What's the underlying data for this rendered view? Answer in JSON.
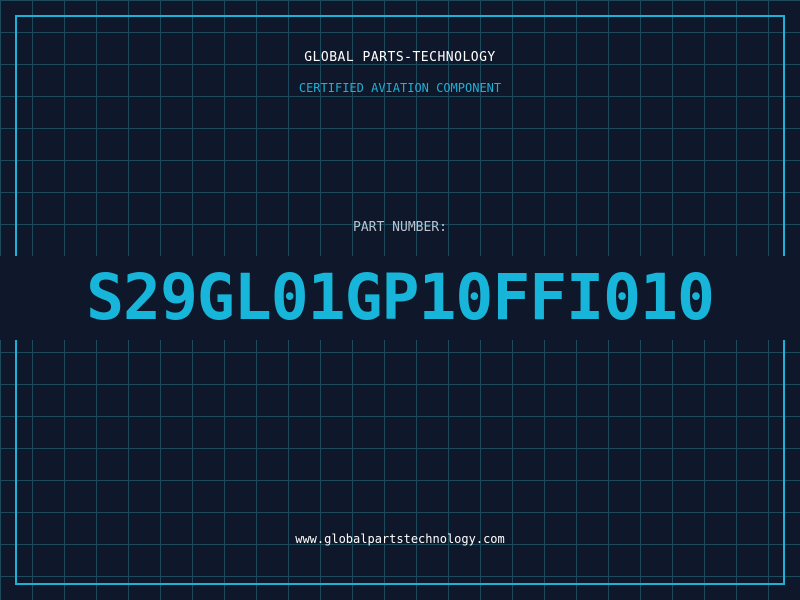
{
  "header": {
    "company": "GLOBAL PARTS-TECHNOLOGY",
    "subtitle": "CERTIFIED AVIATION COMPONENT"
  },
  "part": {
    "label": "PART NUMBER:",
    "number": "S29GL01GP10FFI010"
  },
  "footer": {
    "url": "www.globalpartstechnology.com"
  },
  "colors": {
    "background": "#0f172a",
    "grid": "#1d4a5c",
    "accent": "#1fb0d6",
    "text": "#ffffff",
    "label": "#b9c4d0"
  }
}
